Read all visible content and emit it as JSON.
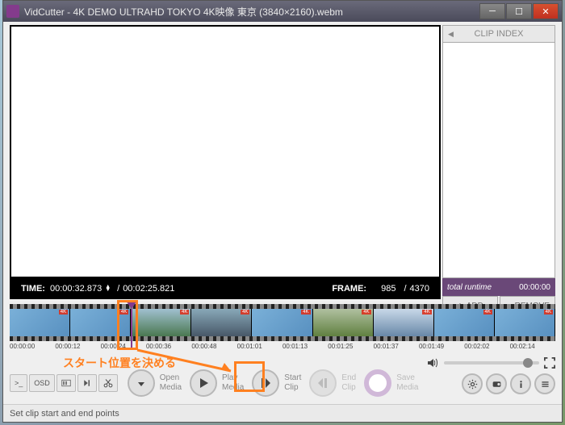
{
  "title": "VidCutter - 4K DEMO ULTRAHD TOKYO 4K映像 東京 (3840×2160).webm",
  "clip_index": {
    "header": "CLIP INDEX",
    "runtime_label": "total runtime",
    "runtime_value": "00:00:00",
    "add": "ADD",
    "remove": "REMOVE"
  },
  "playback": {
    "time_label": "TIME:",
    "current": "00:00:32.873",
    "separator": "/",
    "duration": "00:02:25.821",
    "frame_label": "FRAME:",
    "frame_current": "985",
    "frame_total": "4370"
  },
  "timeline_ticks": [
    "00:00:00",
    "00:00:12",
    "00:00:24",
    "00:00:36",
    "00:00:48",
    "00:01:01",
    "00:01:13",
    "00:01:25",
    "00:01:37",
    "00:01:49",
    "00:02:02",
    "00:02:14"
  ],
  "toolbar": {
    "osd": "OSD",
    "open": "Open\nMedia",
    "play": "Play\nMedia",
    "start": "Start\nClip",
    "end": "End\nClip",
    "save": "Save\nMedia"
  },
  "status": "Set clip start and end points",
  "annotation": "スタート位置を決める"
}
